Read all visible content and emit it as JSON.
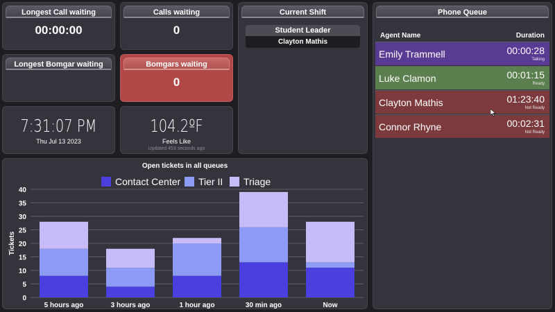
{
  "cards": {
    "longest_call": {
      "title": "Longest Call waiting",
      "value": "00:00:00"
    },
    "calls_waiting": {
      "title": "Calls waiting",
      "value": "0"
    },
    "longest_bomgar": {
      "title": "Longest Bomgar waiting",
      "value": ""
    },
    "bomgars_waiting": {
      "title": "Bomgars waiting",
      "value": "0"
    }
  },
  "clock": {
    "time": "7:31:07 PM",
    "date": "Thu Jul 13 2023"
  },
  "weather": {
    "temp": "104.2ºF",
    "label": "Feels Like",
    "updated": "Updated 453 seconds ago"
  },
  "shift": {
    "title": "Current Shift",
    "role": "Student Leader",
    "name": "Clayton Mathis"
  },
  "queue": {
    "title": "Phone Queue",
    "col_agent": "Agent Name",
    "col_duration": "Duration",
    "rows": [
      {
        "name": "Emily Trammell",
        "duration": "00:00:28",
        "status": "Talking",
        "color": "#5a3b94"
      },
      {
        "name": "Luke Clamon",
        "duration": "00:01:15",
        "status": "Ready",
        "color": "#5b7f4e"
      },
      {
        "name": "Clayton Mathis",
        "duration": "01:23:40",
        "status": "Not Ready",
        "color": "#7c3a3c"
      },
      {
        "name": "Connor Rhyne",
        "duration": "00:02:31",
        "status": "Not Ready",
        "color": "#7c3a3c"
      }
    ]
  },
  "chart_data": {
    "type": "bar",
    "stacked": true,
    "title": "Open tickets in all queues",
    "ylabel": "Tickets",
    "xlabel": "",
    "ylim": [
      0,
      40
    ],
    "yticks": [
      0,
      5,
      10,
      15,
      20,
      25,
      30,
      35,
      40
    ],
    "categories": [
      "5 hours ago",
      "3 hours ago",
      "1 hour ago",
      "30 min ago",
      "Now"
    ],
    "series": [
      {
        "name": "Contact Center",
        "color": "#4b3fe0",
        "values": [
          8,
          4,
          8,
          13,
          11
        ]
      },
      {
        "name": "Tier II",
        "color": "#8c9cf4",
        "values": [
          10,
          7,
          12,
          13,
          2
        ]
      },
      {
        "name": "Triage",
        "color": "#c8bcf8",
        "values": [
          10,
          7,
          2,
          13,
          15
        ]
      }
    ],
    "legend": "top",
    "grid": true
  }
}
